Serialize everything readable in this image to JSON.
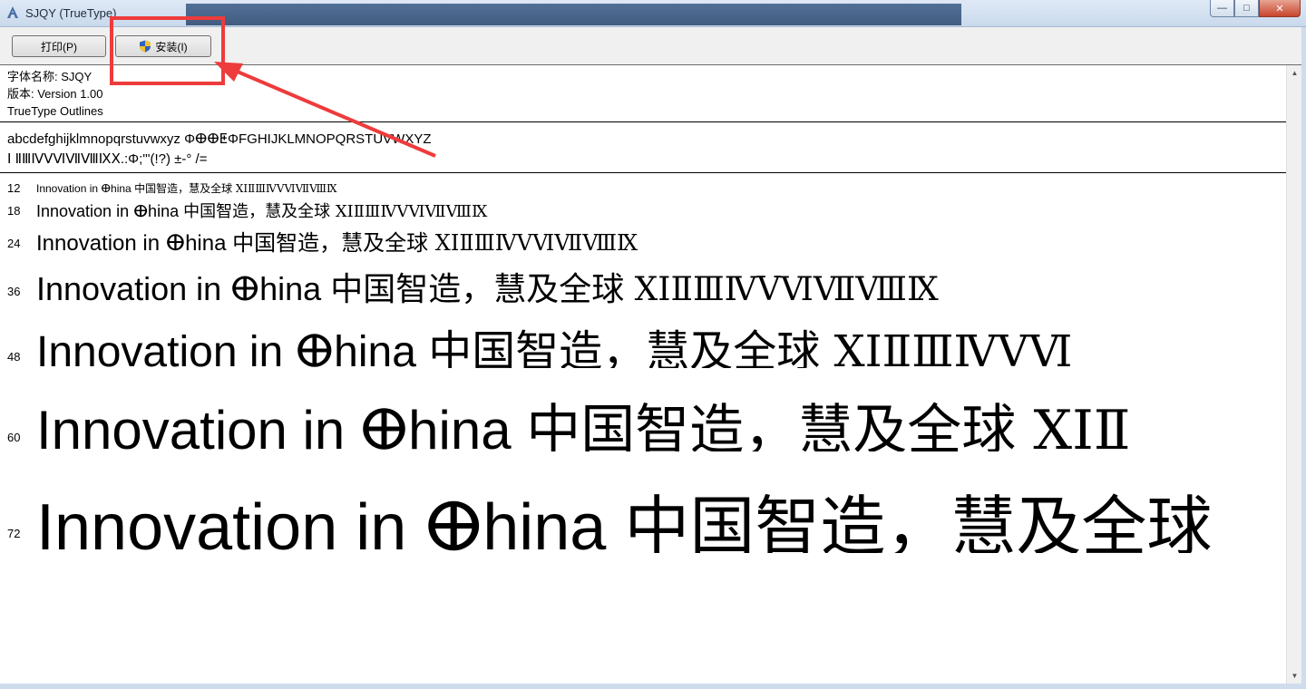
{
  "window": {
    "title": "SJQY (TrueType)",
    "minimize_glyph": "—",
    "maximize_glyph": "□",
    "close_glyph": "✕"
  },
  "toolbar": {
    "print_label": "打印(P)",
    "install_label": "安装(I)"
  },
  "font_info": {
    "name_line": "字体名称: SJQY",
    "version_line": "版本: Version 1.00",
    "outline_line": "TrueType Outlines"
  },
  "charset": {
    "line1": "abcdefghijklmnopqrstuvwxyz ΦⴲⴲⵟΦFGHIJKLMNOPQRSTUVWXYZ",
    "line2": "Ⅰ ⅡⅢⅣⅤⅥⅦⅧⅨⅩ.:Φ;'\"(!?) ±-° /="
  },
  "samples": [
    {
      "size": "12",
      "latin": "Innovation in ⴲhina ",
      "cjk": "中国智造，慧及全球 ⅩⅠⅡⅢⅣⅤⅥⅦⅧⅨ"
    },
    {
      "size": "18",
      "latin": "Innovation in ⴲhina ",
      "cjk": "中国智造，慧及全球 ⅩⅠⅡⅢⅣⅤⅥⅦⅧⅨ"
    },
    {
      "size": "24",
      "latin": "Innovation in ⴲhina ",
      "cjk": "中国智造，慧及全球 ⅩⅠⅡⅢⅣⅤⅥⅦⅧⅨ"
    },
    {
      "size": "36",
      "latin": "Innovation in ⴲhina ",
      "cjk": "中国智造，慧及全球 ⅩⅠⅡⅢⅣⅤⅥⅦⅧⅨ"
    },
    {
      "size": "48",
      "latin": "Innovation in ⴲhina ",
      "cjk": "中国智造，慧及全球 ⅩⅠⅡⅢⅣⅤⅥ"
    },
    {
      "size": "60",
      "latin": "Innovation in ⴲhina ",
      "cjk": "中国智造，慧及全球 ⅩⅠⅡ"
    },
    {
      "size": "72",
      "latin": "Innovation in ⴲhina ",
      "cjk": "中国智造，慧及全球"
    }
  ],
  "scrollbar": {
    "up_glyph": "▲",
    "down_glyph": "▼"
  },
  "colors": {
    "annotation_red": "#ee3b3b"
  }
}
